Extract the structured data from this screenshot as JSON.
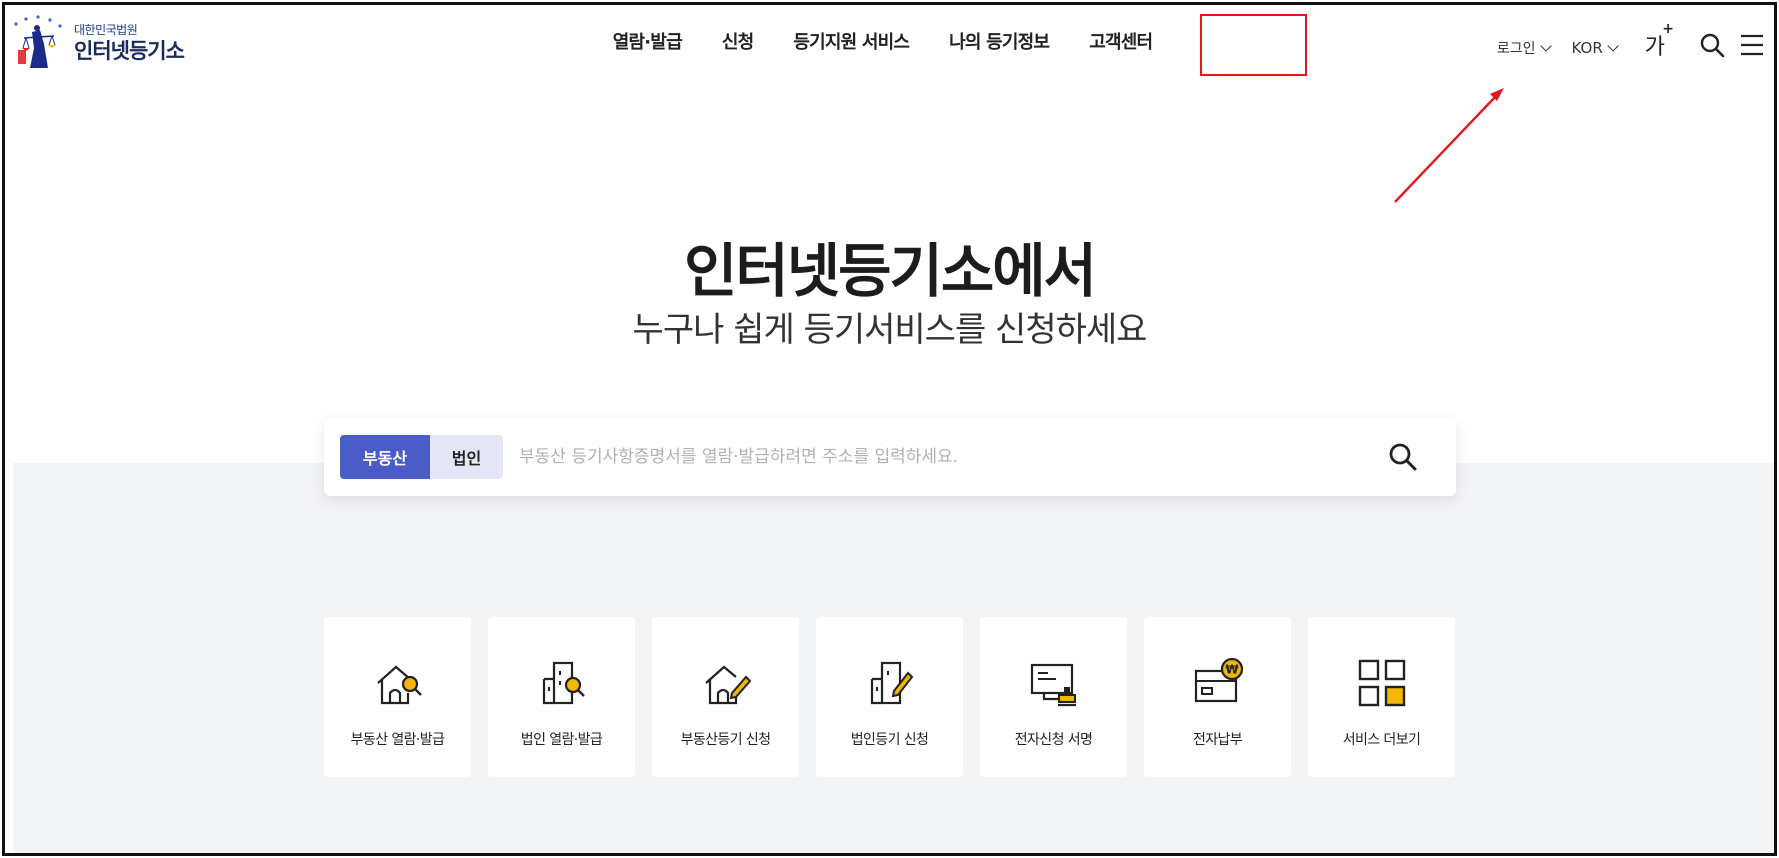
{
  "header": {
    "logo_sub": "대한민국법원",
    "logo_main": "인터넷등기소",
    "nav": [
      "열람·발급",
      "신청",
      "등기지원 서비스",
      "나의 등기정보",
      "고객센터"
    ],
    "login_label": "로그인",
    "lang_label": "KOR",
    "fontsize_label": "가",
    "fontsize_plus": "+"
  },
  "hero": {
    "title": "인터넷등기소에서",
    "subtitle": "누구나 쉽게 등기서비스를 신청하세요"
  },
  "search": {
    "tabs": [
      "부동산",
      "법인"
    ],
    "active_tab": "부동산",
    "placeholder": "부동산 등기사항증명서를 열람·발급하려면 주소를 입력하세요."
  },
  "services": [
    {
      "label": "부동산 열람·발급",
      "icon": "house-search-icon"
    },
    {
      "label": "법인 열람·발급",
      "icon": "building-search-icon"
    },
    {
      "label": "부동산등기 신청",
      "icon": "house-pencil-icon"
    },
    {
      "label": "법인등기 신청",
      "icon": "building-pencil-icon"
    },
    {
      "label": "전자신청 서명",
      "icon": "e-sign-icon"
    },
    {
      "label": "전자납부",
      "icon": "e-payment-icon"
    },
    {
      "label": "서비스 더보기",
      "icon": "grid-more-icon"
    }
  ],
  "colors": {
    "accent": "#4a5cc7",
    "accent_light": "#e4e6f6",
    "icon_yellow": "#f2b705",
    "annotation_red": "#e3161b",
    "band_gray": "#f3f4f6"
  }
}
